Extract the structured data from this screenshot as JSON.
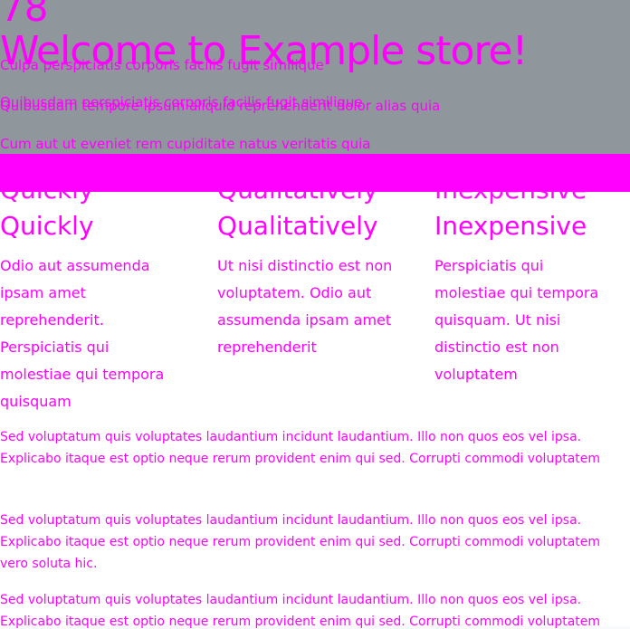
{
  "hero": {
    "number": "78",
    "title": "Welcome to Example store!",
    "lines": [
      "Quibusdam perspiciatis corporis facilis fugit similique",
      "Quibusdam perspiciatis corporis facilis fugit similique",
      "Culpa perspiciatis corporis facilis fugit similique",
      "Quibusdam tempore ipsum aliquid reprehenderit dolor alias quia",
      "Cum aut ut eveniet rem cupiditate natus veritatis quia"
    ]
  },
  "columns": [
    {
      "title": "Quickly",
      "title_ghost": "Quickly",
      "text_lines": [
        "Odio aut assumenda",
        "ipsam amet",
        "reprehenderit.",
        "Perspiciatis qui",
        "molestiae qui tempora",
        "quisquam"
      ]
    },
    {
      "title": "Qualitatively",
      "title_ghost": "Qualitatively",
      "text_lines": [
        "Ut nisi distinctio est non",
        "voluptatem. Odio aut",
        "assumenda ipsam amet",
        "reprehenderit"
      ]
    },
    {
      "title": "Inexpensive",
      "title_ghost": "Inexpensive",
      "text_lines": [
        "Perspiciatis qui",
        "molestiae qui tempora",
        "quisquam. Ut nisi",
        "distinctio est non",
        "voluptatem"
      ]
    }
  ],
  "footer": {
    "line1": "Sed voluptatum quis voluptates laudantium incidunt laudantium. Illo non quos eos vel ipsa.",
    "line2": "Explicabo itaque est optio neque rerum provident enim qui sed. Corrupti commodi voluptatem",
    "line3": "vero soluta hic.",
    "line4": "Sed voluptatum quis voluptates laudantium incidunt laudantium. Illo non quos eos vel ipsa.",
    "line5": "Explicabo itaque est optio neque rerum provident enim qui sed. Corrupti commodi voluptatem"
  }
}
